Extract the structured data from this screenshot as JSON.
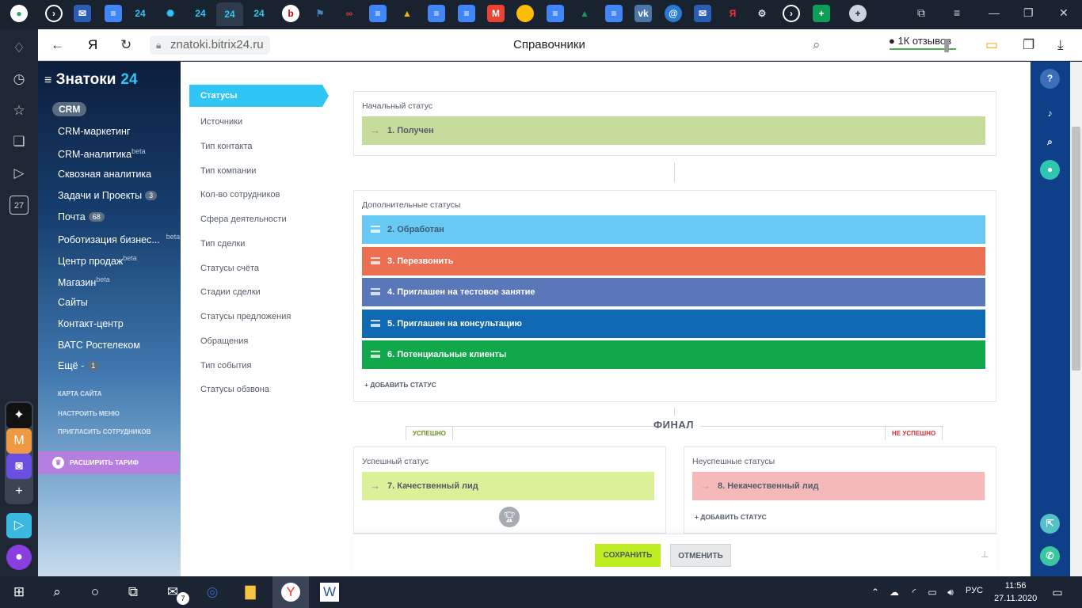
{
  "browser": {
    "tabs": [
      "bitrix-tab",
      "mail-tab",
      "docs-tab",
      "b24-tab",
      "settings-tab",
      "b24-tab",
      "b24-active-tab",
      "b24-tab",
      "opera-tab",
      "flag-tab",
      "link-tab",
      "docs-tab",
      "drive-tab",
      "docs-tab",
      "docs-tab",
      "gmail-tab",
      "chrome-tab",
      "docs-tab",
      "drive-tab",
      "docs-tab",
      "vk-tab",
      "at-tab",
      "mail-tab",
      "yandex-tab",
      "gear-tab",
      "bitrix-tab",
      "sheets-tab"
    ],
    "active_tab_label": "24",
    "url": "znatoki.bitrix24.ru",
    "page_title": "Справочники",
    "reviews": "1К отзывов",
    "yandex_label": "Я",
    "side_calendar": "27"
  },
  "portal": {
    "name": "Знатоки",
    "name_num": "24",
    "crm_badge": "CRM"
  },
  "nav": {
    "items": [
      {
        "label": "CRM-маркетинг"
      },
      {
        "label": "CRM-аналитика",
        "sup": "beta"
      },
      {
        "label": "Сквозная аналитика"
      },
      {
        "label": "Задачи и Проекты",
        "count": "3"
      },
      {
        "label": "Почта",
        "count": "68"
      },
      {
        "label": "Роботизация бизнес...",
        "sup": "beta"
      },
      {
        "label": "Центр продаж",
        "sup": "beta"
      },
      {
        "label": "Магазин",
        "sup": "beta"
      },
      {
        "label": "Сайты"
      },
      {
        "label": "Контакт-центр"
      },
      {
        "label": "ВАТС Ростелеком"
      },
      {
        "label": "Ещё",
        "count": "1"
      }
    ],
    "more_dash": "-",
    "small": [
      "Карта сайта",
      "Настроить меню",
      "Пригласить сотрудников"
    ],
    "tariff": "РАСШИРИТЬ ТАРИФ"
  },
  "settings_menu": {
    "active": "Статусы",
    "items": [
      "Источники",
      "Тип контакта",
      "Тип компании",
      "Кол-во сотрудников",
      "Сфера деятельности",
      "Тип сделки",
      "Статусы счёта",
      "Стадии сделки",
      "Статусы предложения",
      "Обращения",
      "Тип события",
      "Статусы обзвона"
    ]
  },
  "statuses": {
    "initial_title": "Начальный статус",
    "initial": {
      "label": "1. Получен",
      "color": "#c6dc9c"
    },
    "extra_title": "Дополнительные статусы",
    "extra": [
      {
        "label": "2. Обработан",
        "color": "#68c9f5",
        "text_color": "#3e5a73"
      },
      {
        "label": "3. Перезвонить",
        "color": "#ec6f52",
        "text_color": "#ffffff"
      },
      {
        "label": "4. Приглашен на тестовое занятие",
        "color": "#5a77b9",
        "text_color": "#ffffff"
      },
      {
        "label": "5. Приглашен на консультацию",
        "color": "#1069b3",
        "text_color": "#ffffff"
      },
      {
        "label": "6. Потенциальные клиенты",
        "color": "#11a84c",
        "text_color": "#ffffff"
      }
    ],
    "add_status": "+ ДОБАВИТЬ СТАТУС",
    "final_label": "ФИНАЛ",
    "success_tab": "УСПЕШНО",
    "fail_tab": "НЕ УСПЕШНО",
    "success_title": "Успешный статус",
    "success": {
      "label": "7. Качественный лид",
      "color": "#dbf199"
    },
    "fail_title": "Неуспешные статусы",
    "fail": {
      "label": "8. Некачественный лид",
      "color": "#f6b9b9"
    },
    "add_status_fail": "+ ДОБАВИТЬ СТАТУС"
  },
  "footer": {
    "save": "СОХРАНИТЬ",
    "cancel": "ОТМЕНИТЬ"
  },
  "taskbar": {
    "mail_badge": "7",
    "lang": "РУС",
    "time": "11:56",
    "date": "27.11.2020"
  }
}
